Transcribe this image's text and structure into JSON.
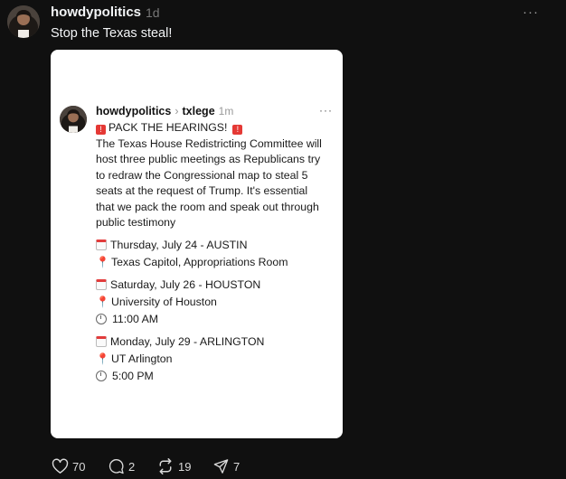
{
  "post": {
    "username": "howdypolitics",
    "time": "1d",
    "more_label": "···",
    "text": "Stop the Texas steal!"
  },
  "embedded": {
    "username": "howdypolitics",
    "separator": "›",
    "target": "txlege",
    "time": "1m",
    "more_label": "···",
    "headline": "PACK THE HEARINGS!",
    "body_lines": [
      "The Texas House Redistricting Committee will",
      "host three public meetings as Republicans try",
      "to redraw the Congressional map to steal 5",
      "seats at the request of Trump. It's essential",
      "that we pack the room and speak out through",
      "public testimony"
    ],
    "events": [
      {
        "date": "Thursday, July 24 - AUSTIN",
        "place": "Texas Capitol, Appropriations Room"
      },
      {
        "date": "Saturday, July 26 - HOUSTON",
        "place": "University of Houston",
        "time": "11:00 AM"
      },
      {
        "date": "Monday, July 29 - ARLINGTON",
        "place": "UT Arlington",
        "time": "5:00 PM"
      }
    ]
  },
  "actions": {
    "likes": "70",
    "comments": "2",
    "reposts": "19",
    "shares": "7"
  },
  "icons": [
    "heart-icon",
    "comment-icon",
    "repost-icon",
    "share-icon",
    "calendar-icon",
    "pin-icon",
    "clock-icon",
    "siren-icon"
  ],
  "colors": {
    "background": "#101010",
    "card": "#ffffff",
    "text": "#f3f5f7",
    "muted": "#777777"
  }
}
